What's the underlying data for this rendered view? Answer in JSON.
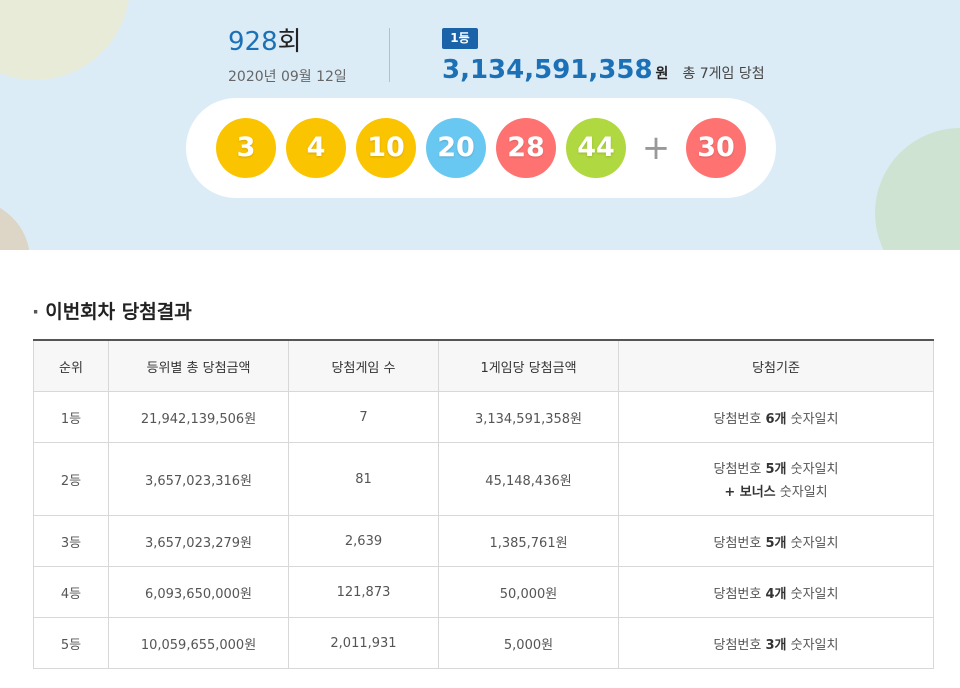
{
  "header": {
    "draw_number": "928",
    "draw_suffix": "회",
    "draw_date": "2020년 09월 12일",
    "rank_badge": "1등",
    "first_prize_amount": "3,134,591,358",
    "first_prize_unit": "원",
    "winner_summary": "총 7게임 당첨"
  },
  "numbers": {
    "winning": [
      {
        "value": "3",
        "color": "#fbc400"
      },
      {
        "value": "4",
        "color": "#fbc400"
      },
      {
        "value": "10",
        "color": "#fbc400"
      },
      {
        "value": "20",
        "color": "#69c8f2"
      },
      {
        "value": "28",
        "color": "#ff7272"
      },
      {
        "value": "44",
        "color": "#b0d840"
      }
    ],
    "plus": "+",
    "bonus": {
      "value": "30",
      "color": "#ff7272"
    }
  },
  "section": {
    "bullet": "·",
    "title": "이번회차 당첨결과"
  },
  "table": {
    "headers": [
      "순위",
      "등위별 총 당첨금액",
      "당첨게임 수",
      "1게임당 당첨금액",
      "당첨기준"
    ],
    "rows": [
      {
        "rank": "1등",
        "total": "21,942,139,506원",
        "games": "7",
        "per_game": "3,134,591,358원",
        "c_pre": "당첨번호 ",
        "c_bold": "6개",
        "c_post": " 숫자일치",
        "c2_bold": "",
        "c2_post": ""
      },
      {
        "rank": "2등",
        "total": "3,657,023,316원",
        "games": "81",
        "per_game": "45,148,436원",
        "c_pre": "당첨번호 ",
        "c_bold": "5개",
        "c_post": " 숫자일치",
        "c2_bold": "+ 보너스",
        "c2_post": " 숫자일치"
      },
      {
        "rank": "3등",
        "total": "3,657,023,279원",
        "games": "2,639",
        "per_game": "1,385,761원",
        "c_pre": "당첨번호 ",
        "c_bold": "5개",
        "c_post": " 숫자일치",
        "c2_bold": "",
        "c2_post": ""
      },
      {
        "rank": "4등",
        "total": "6,093,650,000원",
        "games": "121,873",
        "per_game": "50,000원",
        "c_pre": "당첨번호 ",
        "c_bold": "4개",
        "c_post": " 숫자일치",
        "c2_bold": "",
        "c2_post": ""
      },
      {
        "rank": "5등",
        "total": "10,059,655,000원",
        "games": "2,011,931",
        "per_game": "5,000원",
        "c_pre": "당첨번호 ",
        "c_bold": "3개",
        "c_post": " 숫자일치",
        "c2_bold": "",
        "c2_post": ""
      }
    ]
  }
}
